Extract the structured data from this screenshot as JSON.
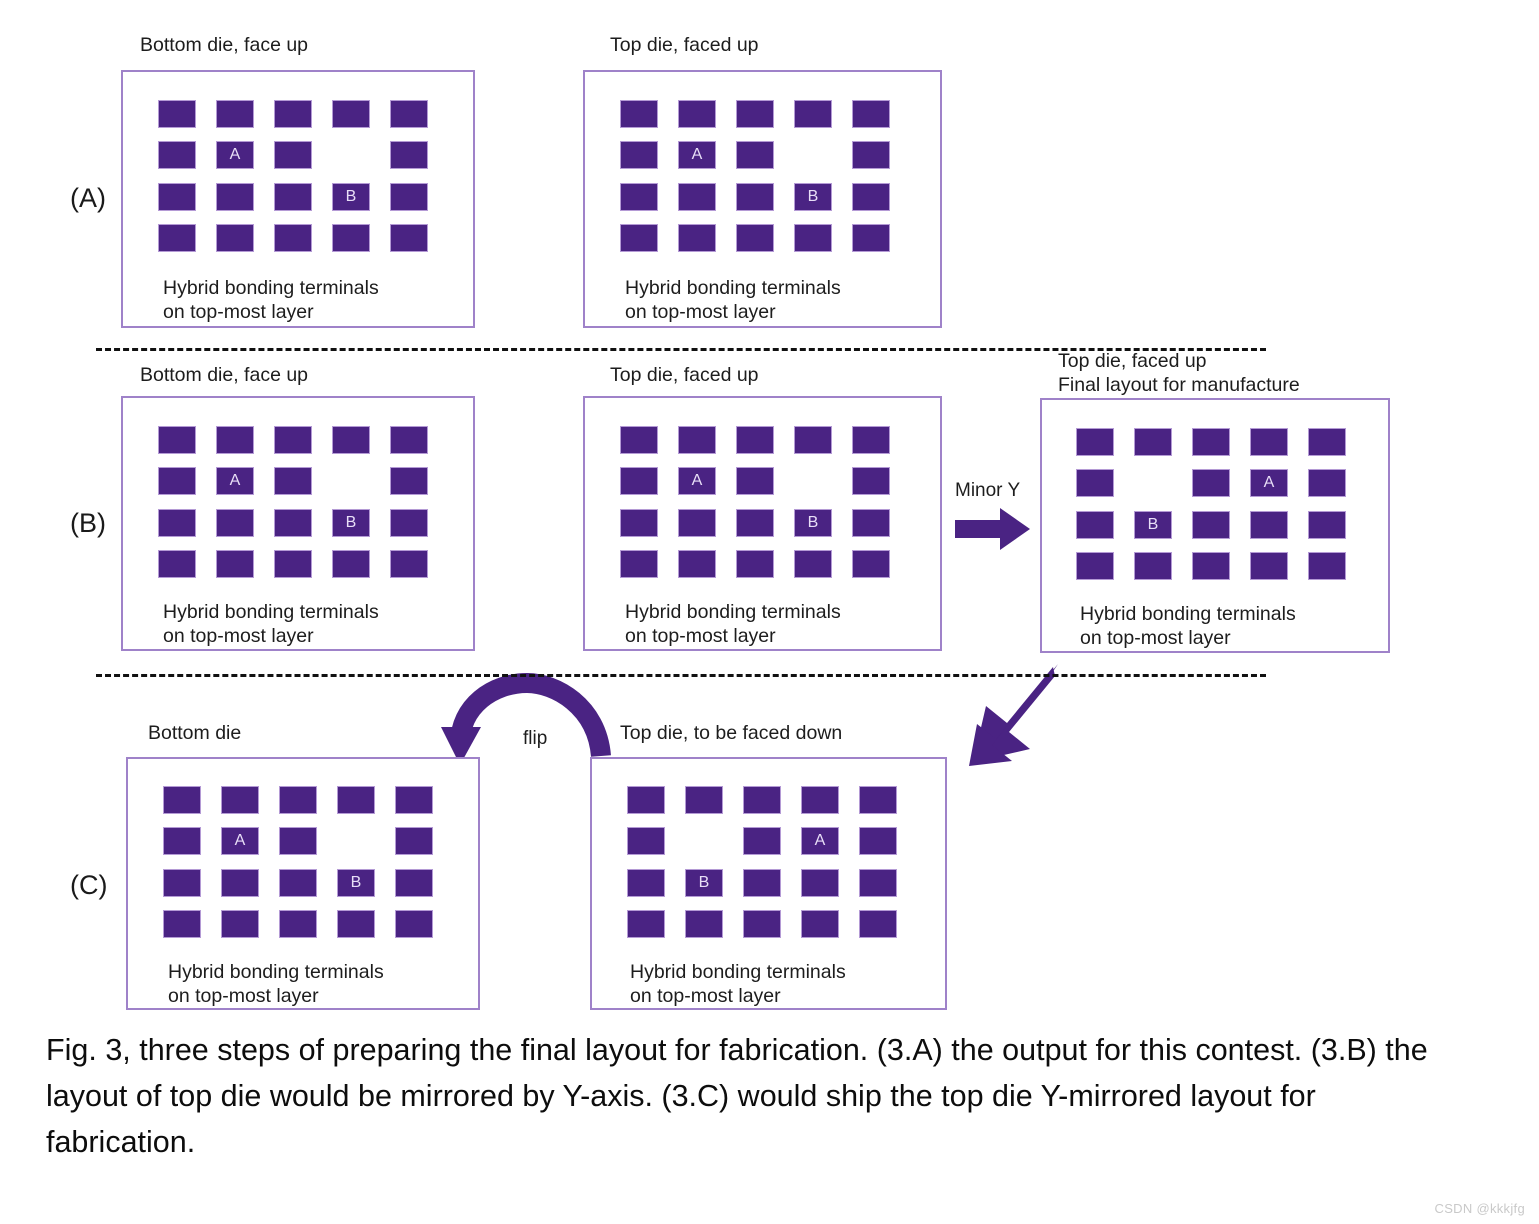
{
  "figure": {
    "caption": "Fig. 3, three steps of preparing the final layout for fabrication. (3.A) the output for this contest. (3.B) the layout of top die would be mirrored by Y-axis. (3.C) would ship the top die Y-mirrored layout for fabrication.",
    "watermark": "CSDN @kkkjfg",
    "terminal_color": "#4a2383",
    "terminal_border_color": "#b49ad5",
    "panel_border_color": "#9f82c9",
    "arrow_color": "#4a2383",
    "separator_color": "#111111"
  },
  "rows": [
    {
      "label": "(A)"
    },
    {
      "label": "(B)"
    },
    {
      "label": "(C)"
    }
  ],
  "panel_footnote": {
    "line1": "Hybrid bonding terminals",
    "line2": "on top-most layer"
  },
  "panels": [
    {
      "id": "a-bottom",
      "row": "(A)",
      "title_lines": [
        "Bottom die, face up"
      ],
      "grid": [
        [
          "",
          "",
          "",
          "",
          ""
        ],
        [
          "",
          "A",
          "",
          null,
          ""
        ],
        [
          "",
          "",
          "",
          "B",
          ""
        ],
        [
          "",
          "",
          "",
          "",
          ""
        ]
      ],
      "footnote": [
        "Hybrid bonding terminals",
        "on top-most layer"
      ]
    },
    {
      "id": "a-top",
      "row": "(A)",
      "title_lines": [
        "Top die, faced up"
      ],
      "grid": [
        [
          "",
          "",
          "",
          "",
          ""
        ],
        [
          "",
          "A",
          "",
          null,
          ""
        ],
        [
          "",
          "",
          "",
          "B",
          ""
        ],
        [
          "",
          "",
          "",
          "",
          ""
        ]
      ],
      "footnote": [
        "Hybrid bonding terminals",
        "on top-most layer"
      ]
    },
    {
      "id": "b-bottom",
      "row": "(B)",
      "title_lines": [
        "Bottom die, face up"
      ],
      "grid": [
        [
          "",
          "",
          "",
          "",
          ""
        ],
        [
          "",
          "A",
          "",
          null,
          ""
        ],
        [
          "",
          "",
          "",
          "B",
          ""
        ],
        [
          "",
          "",
          "",
          "",
          ""
        ]
      ],
      "footnote": [
        "Hybrid bonding terminals",
        "on top-most layer"
      ]
    },
    {
      "id": "b-top",
      "row": "(B)",
      "title_lines": [
        "Top die, faced up"
      ],
      "grid": [
        [
          "",
          "",
          "",
          "",
          ""
        ],
        [
          "",
          "A",
          "",
          null,
          ""
        ],
        [
          "",
          "",
          "",
          "B",
          ""
        ],
        [
          "",
          "",
          "",
          "",
          ""
        ]
      ],
      "footnote": [
        "Hybrid bonding terminals",
        "on top-most layer"
      ]
    },
    {
      "id": "b-final",
      "row": "(B)",
      "title_lines": [
        "Top die, faced up",
        "Final layout for manufacture"
      ],
      "grid": [
        [
          "",
          "",
          "",
          "",
          ""
        ],
        [
          "",
          null,
          "",
          "A",
          ""
        ],
        [
          "",
          "B",
          "",
          "",
          ""
        ],
        [
          "",
          "",
          "",
          "",
          ""
        ]
      ],
      "footnote": [
        "Hybrid bonding terminals",
        "on top-most layer"
      ]
    },
    {
      "id": "c-bottom",
      "row": "(C)",
      "title_lines": [
        "Bottom die"
      ],
      "grid": [
        [
          "",
          "",
          "",
          "",
          ""
        ],
        [
          "",
          "A",
          "",
          null,
          ""
        ],
        [
          "",
          "",
          "",
          "B",
          ""
        ],
        [
          "",
          "",
          "",
          "",
          ""
        ]
      ],
      "footnote": [
        "Hybrid bonding terminals",
        "on top-most layer"
      ]
    },
    {
      "id": "c-top",
      "row": "(C)",
      "title_lines": [
        "Top die, to be faced down"
      ],
      "grid": [
        [
          "",
          "",
          "",
          "",
          ""
        ],
        [
          "",
          null,
          "",
          "A",
          ""
        ],
        [
          "",
          "B",
          "",
          "",
          ""
        ],
        [
          "",
          "",
          "",
          "",
          ""
        ]
      ],
      "footnote": [
        "Hybrid bonding terminals",
        "on top-most layer"
      ]
    }
  ],
  "arrows": {
    "minor_y_label": "Minor Y",
    "flip_label": "flip"
  }
}
